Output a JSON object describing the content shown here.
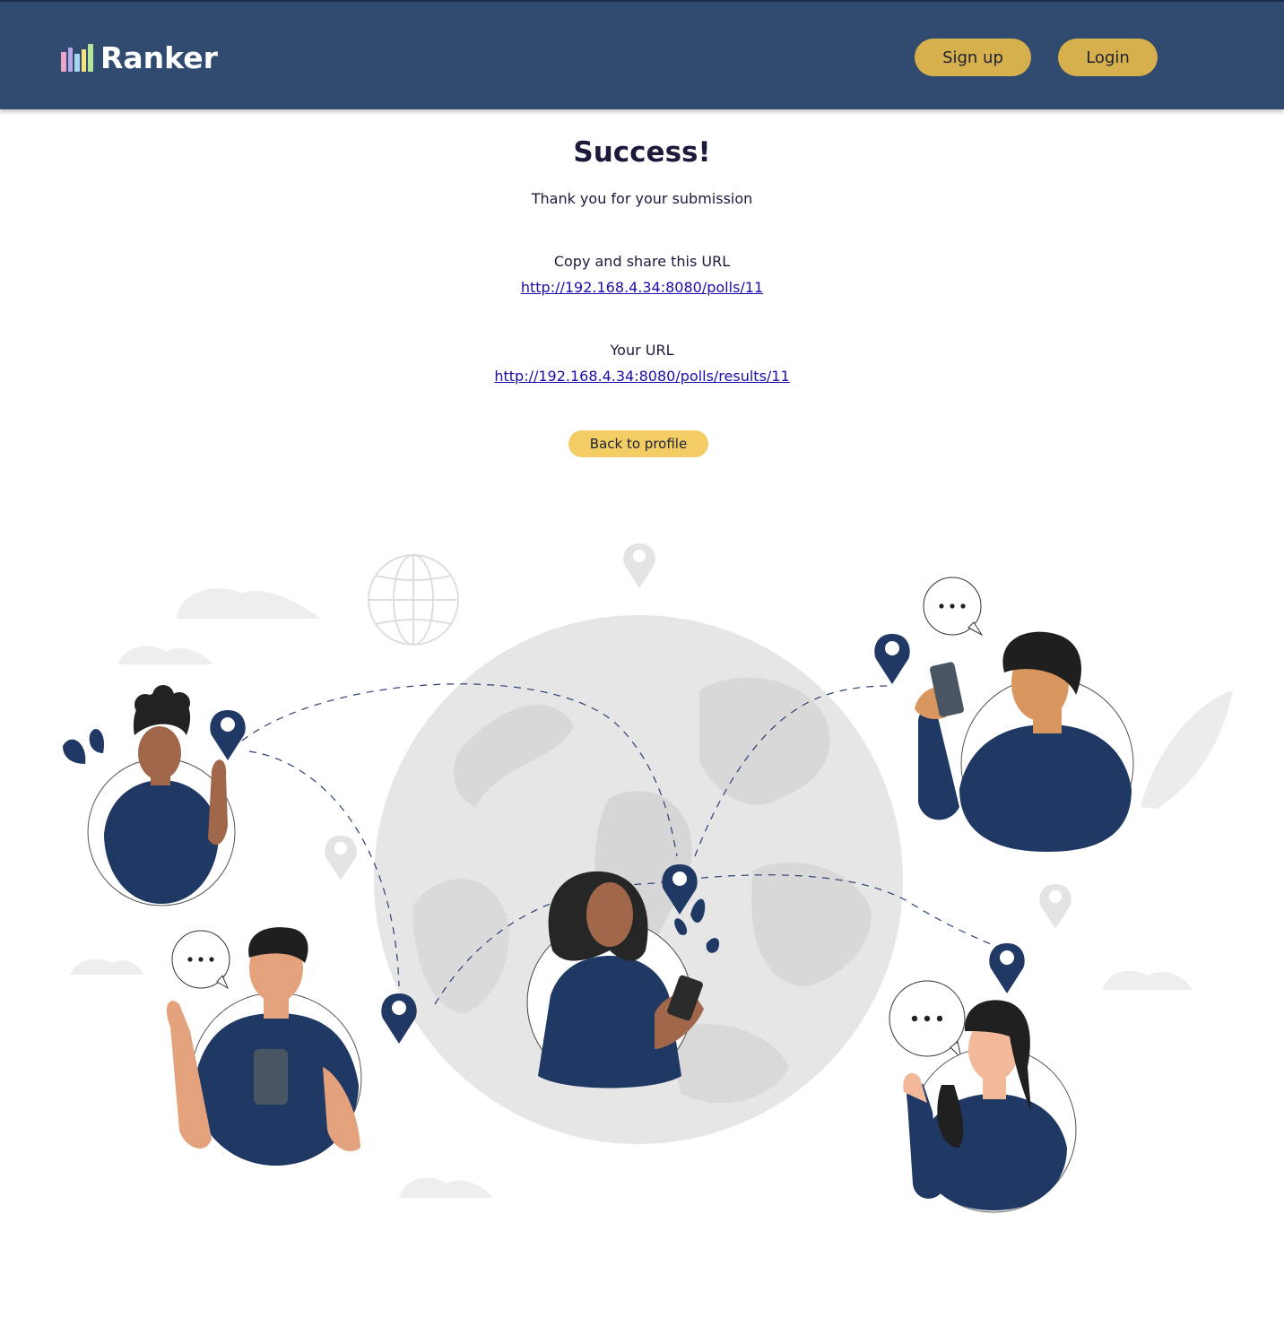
{
  "header": {
    "brand_name": "Ranker",
    "brand_bar_colors": [
      "#e9a6c8",
      "#b7a6e6",
      "#a6d4f0",
      "#f3e27a",
      "#b6e39a"
    ],
    "signup_label": "Sign up",
    "login_label": "Login",
    "colors": {
      "bar": "#304a70",
      "button": "#d6b04c"
    }
  },
  "main": {
    "title": "Success!",
    "subtitle": "Thank you for your submission",
    "share_label": "Copy and share this URL",
    "share_url": "http://192.168.4.34:8080/polls/11",
    "your_url_label": "Your URL",
    "your_url": "http://192.168.4.34:8080/polls/results/11",
    "back_label": "Back to profile"
  },
  "illustration": {
    "subject": "people-connected-around-globe-illustration",
    "colors": {
      "navy": "#1f3864",
      "globe": "#e3e3e3",
      "skin_dark": "#a0674a",
      "skin_light": "#e3a27c"
    }
  }
}
